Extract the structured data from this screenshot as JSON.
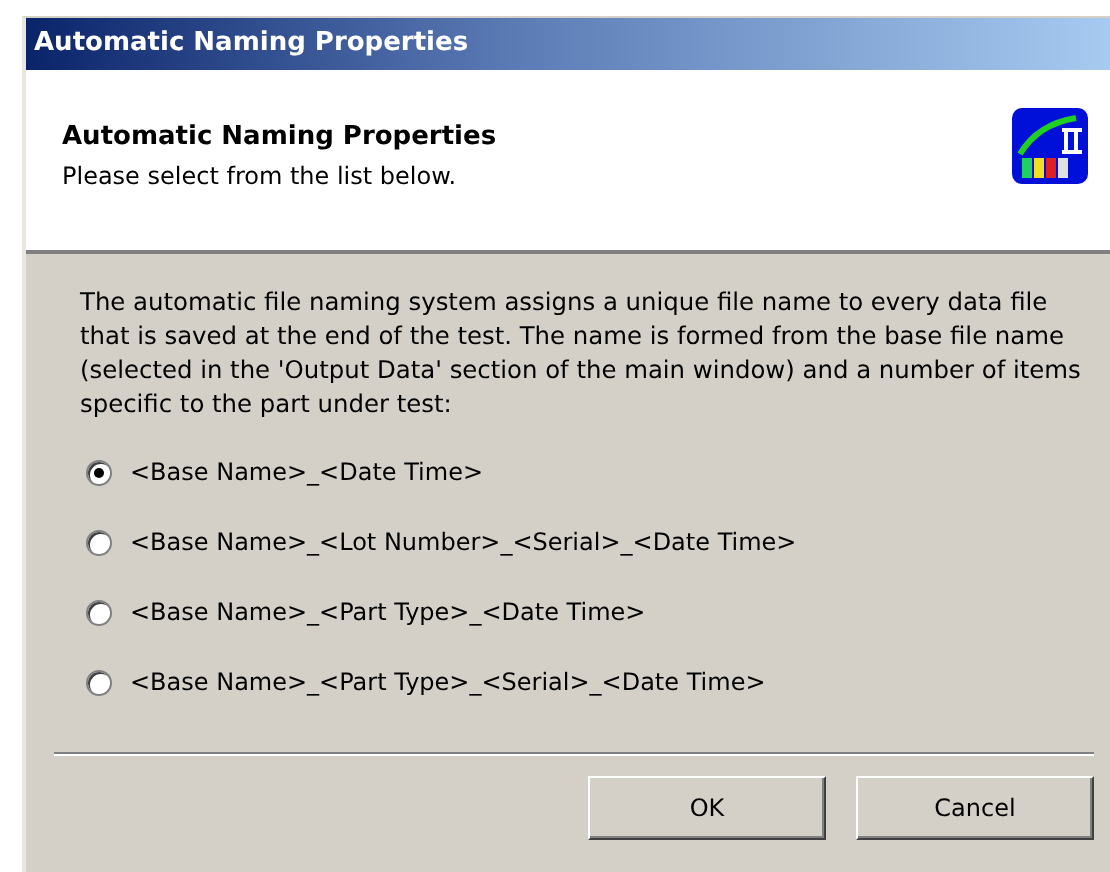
{
  "window": {
    "title": "Automatic Naming Properties"
  },
  "header": {
    "title": "Automatic Naming Properties",
    "subtitle": "Please select from the list below."
  },
  "description": "The automatic file naming system assigns a unique file name to every data file that is saved at the end of the test. The name is formed from the base file name (selected in the 'Output Data' section of the main window) and a number of items specific to the part under test:",
  "options": [
    {
      "label": "<Base Name>_<Date Time>",
      "selected": true
    },
    {
      "label": "<Base Name>_<Lot Number>_<Serial>_<Date Time>",
      "selected": false
    },
    {
      "label": "<Base Name>_<Part Type>_<Date Time>",
      "selected": false
    },
    {
      "label": "<Base Name>_<Part Type>_<Serial>_<Date Time>",
      "selected": false
    }
  ],
  "buttons": [
    "OK",
    "Cancel"
  ]
}
